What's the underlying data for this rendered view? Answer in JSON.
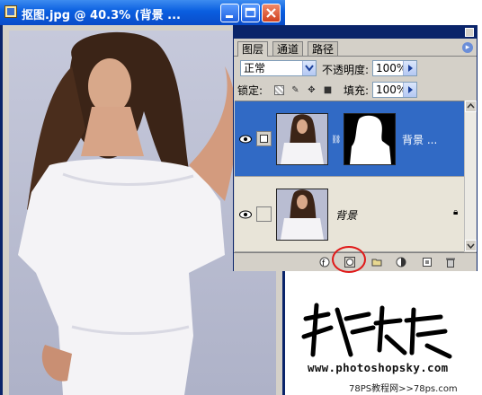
{
  "document_window": {
    "title": "抠图.jpg @ 40.3% (背景 ...",
    "buttons": [
      "minimize",
      "maximize",
      "close"
    ]
  },
  "layers_panel": {
    "tabs": [
      {
        "label": "图层",
        "active": true
      },
      {
        "label": "通道",
        "active": false
      },
      {
        "label": "路径",
        "active": false
      }
    ],
    "blend_mode": "正常",
    "opacity_label": "不透明度:",
    "opacity_value": "100%",
    "lock_label": "锁定:",
    "fill_label": "填充:",
    "fill_value": "100%",
    "layers": [
      {
        "name": "背景 ...",
        "selected": true,
        "has_mask": true
      },
      {
        "name": "背景",
        "selected": false,
        "locked": true
      }
    ],
    "bottom_icons": [
      "link-icon",
      "layer-style-icon",
      "add-mask-icon",
      "new-group-icon",
      "adjustment-layer-icon",
      "new-layer-icon",
      "trash-icon"
    ]
  },
  "watermark": {
    "url": "www.photoshopsky.com",
    "site": "78PS教程网>>78ps.com"
  },
  "colors": {
    "titlebar": "#0a5ee0",
    "selection": "#316ac5",
    "highlight_circle": "#e01818",
    "panel_bg": "#d4d0c8"
  }
}
